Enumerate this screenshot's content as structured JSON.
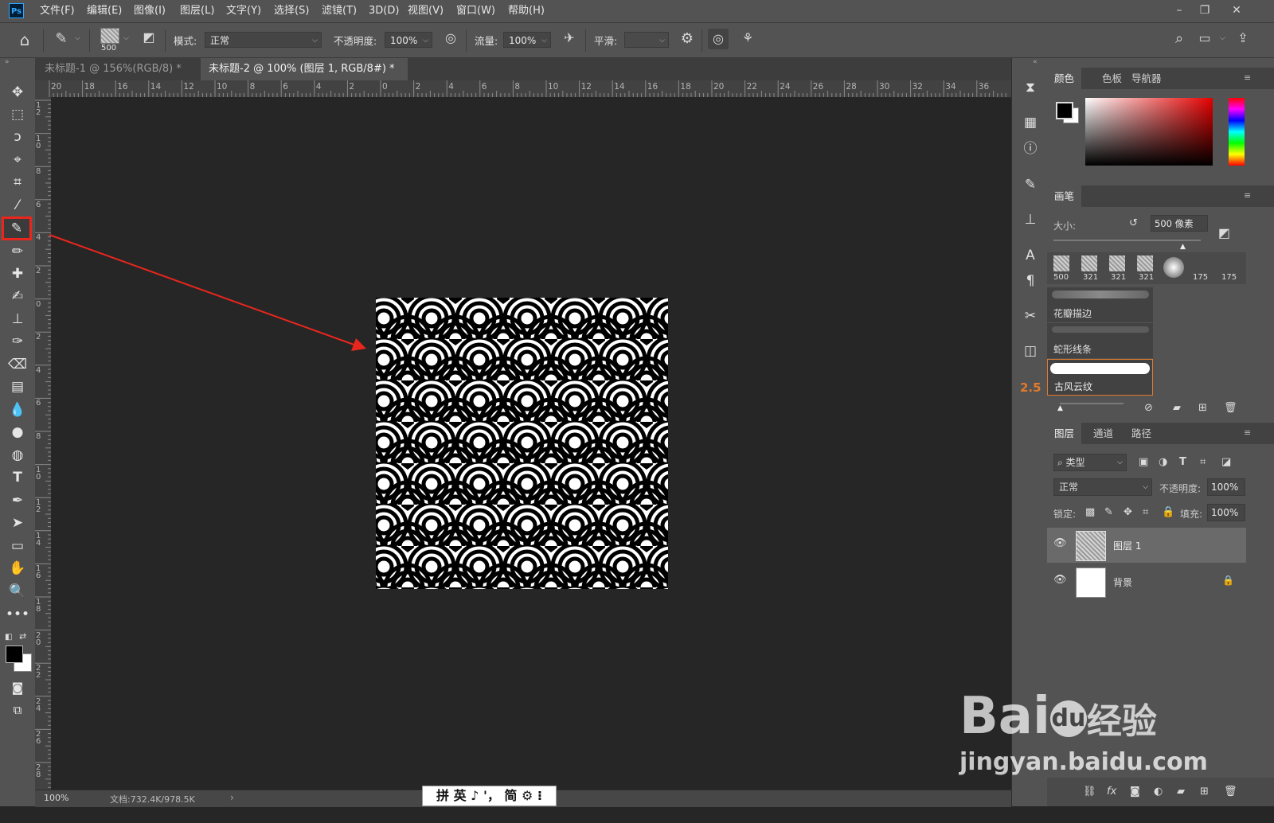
{
  "app": {
    "logo": "Ps"
  },
  "menu": [
    "文件(F)",
    "编辑(E)",
    "图像(I)",
    "图层(L)",
    "文字(Y)",
    "选择(S)",
    "滤镜(T)",
    "3D(D)",
    "视图(V)",
    "窗口(W)",
    "帮助(H)"
  ],
  "options": {
    "brush_size": "500",
    "mode_label": "模式:",
    "mode_value": "正常",
    "opacity_label": "不透明度:",
    "opacity_value": "100%",
    "flow_label": "流量:",
    "flow_value": "100%",
    "smooth_label": "平滑:",
    "smooth_value": ""
  },
  "tabs": [
    {
      "label": "未标题-1 @ 156%(RGB/8) *",
      "close": "×",
      "active": false
    },
    {
      "label": "未标题-2 @ 100% (图层 1, RGB/8#) *",
      "close": "×",
      "active": true
    }
  ],
  "ruler_top": [
    "20",
    "18",
    "16",
    "14",
    "12",
    "10",
    "8",
    "6",
    "4",
    "2",
    "0",
    "2",
    "4",
    "6",
    "8",
    "10",
    "12",
    "14",
    "16",
    "18",
    "20",
    "22",
    "24",
    "26",
    "28",
    "30",
    "32",
    "34",
    "36"
  ],
  "ruler_left": [
    "1 2",
    "1 0",
    "8",
    "6",
    "4",
    "2",
    "0",
    "2",
    "4",
    "6",
    "8",
    "1 0",
    "1 2",
    "1 4",
    "1 6",
    "1 8",
    "2 0",
    "2 2",
    "2 4",
    "2 6",
    "2 8"
  ],
  "status": {
    "zoom": "100%",
    "doc": "文档:732.4K/978.5K"
  },
  "ime": {
    "text": "拼 英 ♪ '， 简 ⚙ ⁝"
  },
  "color_panel": {
    "tabs": [
      "颜色",
      "色板",
      "导航器"
    ],
    "foreground": "#000000",
    "background": "#ffffff"
  },
  "brush_panel": {
    "tab": "画笔",
    "size_label": "大小:",
    "size_value": "500 像素",
    "presets": [
      "500",
      "321",
      "321",
      "321",
      "",
      "175",
      "175"
    ],
    "brushes": [
      "花瓣描边",
      "蛇形线条",
      "古风云纹"
    ]
  },
  "layers_panel": {
    "tabs": [
      "图层",
      "通道",
      "路径"
    ],
    "filter": "类型",
    "blend": "正常",
    "opacity_label": "不透明度:",
    "opacity_value": "100%",
    "lock_label": "锁定:",
    "fill_label": "填充:",
    "fill_value": "100%",
    "layers": [
      {
        "name": "图层 1",
        "selected": true
      },
      {
        "name": "背景",
        "selected": false
      }
    ]
  },
  "strip_badge": "2.5",
  "watermark": {
    "brand": "Bai",
    "brand2": "du",
    "cn": "经验",
    "url": "jingyan.baidu.com"
  },
  "colors": {
    "accent_red": "#e8261d",
    "highlight": "#e07a2d"
  }
}
